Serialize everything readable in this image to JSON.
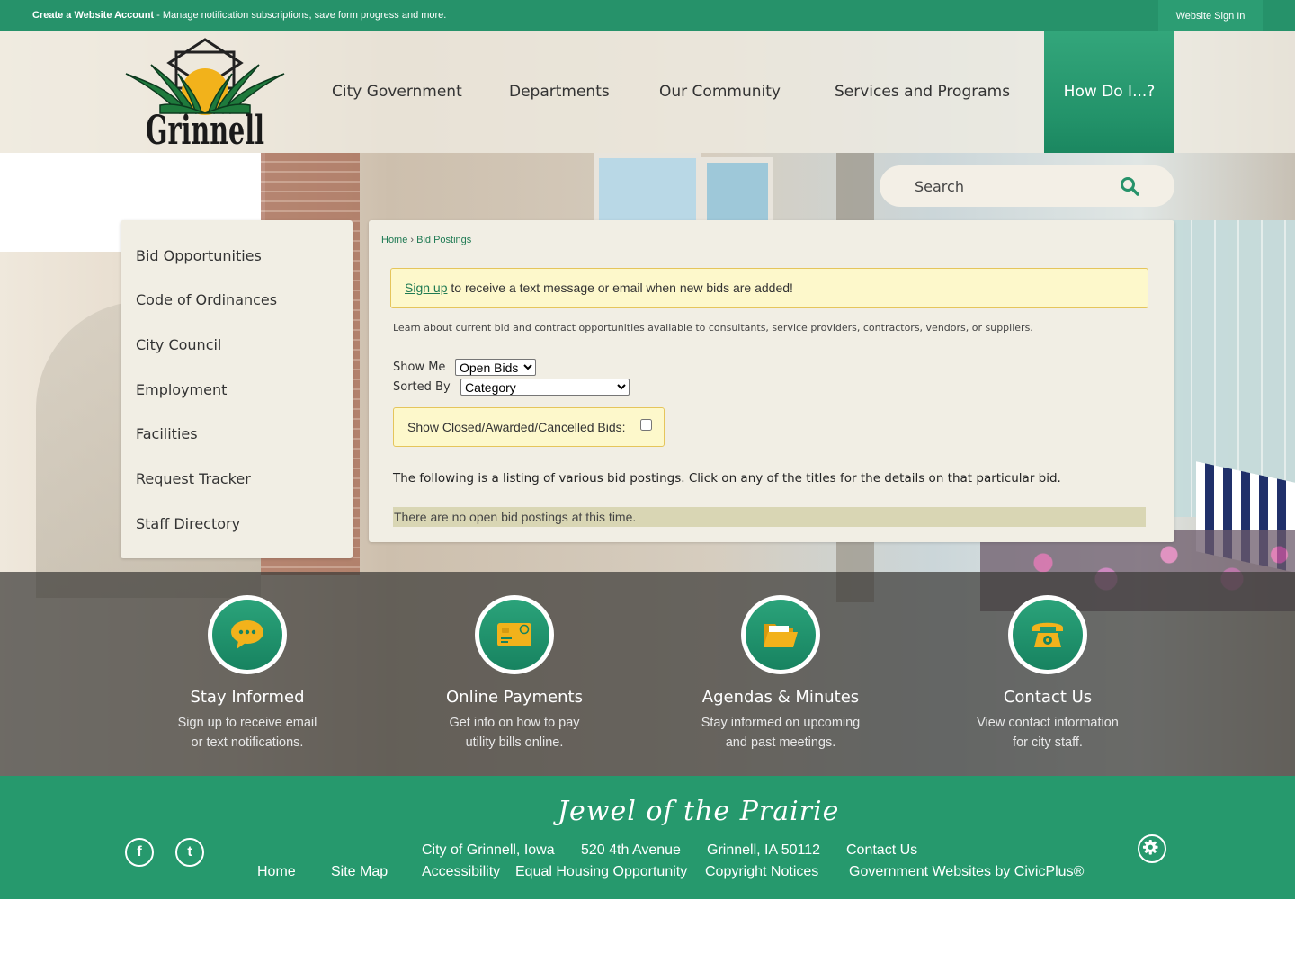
{
  "topbar": {
    "account_link": "Create a Website Account",
    "account_desc": " - Manage notification subscriptions, save form progress and more.",
    "signin": "Website Sign In"
  },
  "logo": {
    "text": "Grinnell"
  },
  "nav": {
    "items": [
      "City Government",
      "Departments",
      "Our Community",
      "Services and Programs"
    ],
    "how_do_i": "How Do I...?"
  },
  "search": {
    "placeholder": "Search"
  },
  "sidebar": {
    "items": [
      "Bid Opportunities",
      "Code of Ordinances",
      "City Council",
      "Employment",
      "Facilities",
      "Request Tracker",
      "Staff Directory"
    ]
  },
  "breadcrumb": {
    "home": "Home",
    "sep": "›",
    "current": "Bid Postings"
  },
  "alert": {
    "link": "Sign up",
    "text": " to receive a text message or email when new bids are added!"
  },
  "intro": "Learn about current bid and contract opportunities available to consultants, service providers, contractors, vendors, or suppliers.",
  "filters": {
    "show_me_label": "Show Me",
    "show_me_value": "Open Bids",
    "sorted_by_label": "Sorted By",
    "sorted_by_value": "Category",
    "closed_label": "Show Closed/Awarded/Cancelled Bids:"
  },
  "listing_text": "The following is a listing of various bid postings. Click on any of the titles for the details on that particular bid.",
  "no_bids": "There are no open bid postings at this time.",
  "features": [
    {
      "title": "Stay Informed",
      "line1": "Sign up to receive email",
      "line2": "or text notifications.",
      "icon": "chat-bubble-icon"
    },
    {
      "title": "Online Payments",
      "line1": "Get info on how to pay",
      "line2": "utility bills online.",
      "icon": "credit-card-icon"
    },
    {
      "title": "Agendas & Minutes",
      "line1": "Stay informed on upcoming",
      "line2": "and past meetings.",
      "icon": "folder-icon"
    },
    {
      "title": "Contact Us",
      "line1": "View contact information",
      "line2": "for city staff.",
      "icon": "telephone-icon"
    }
  ],
  "footer": {
    "tagline": "Jewel of the Prairie",
    "city": "City of Grinnell, Iowa",
    "address": "520 4th Avenue",
    "citystate": "Grinnell, IA 50112",
    "contact": "Contact Us",
    "home": "Home",
    "sitemap": "Site Map",
    "accessibility": "Accessibility",
    "equal_housing": "Equal Housing Opportunity",
    "copyright": "Copyright Notices",
    "civicplus": "Government Websites by CivicPlus®",
    "social": {
      "facebook": "f",
      "twitter": "t"
    }
  },
  "colors": {
    "brand_green": "#26926a",
    "accent_yellow": "#f2b21b",
    "alert_bg": "#fdf8cb"
  }
}
